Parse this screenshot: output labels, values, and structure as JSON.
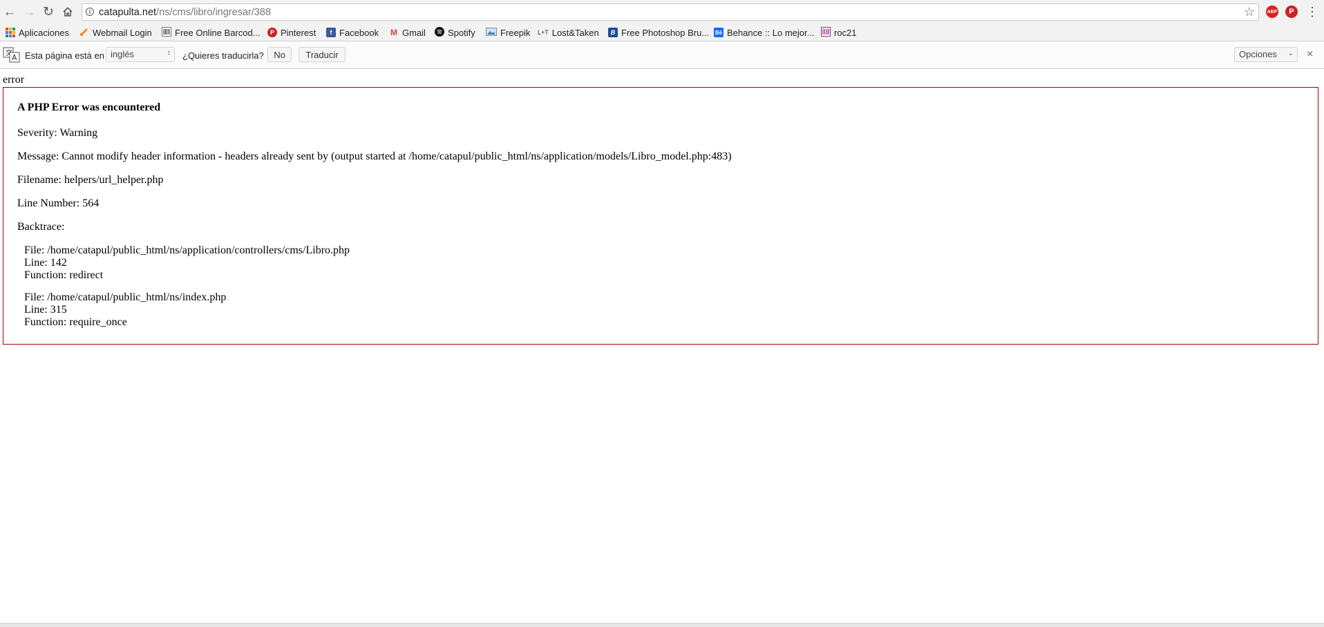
{
  "address_bar": {
    "url_host": "catapulta.net",
    "url_path": "/ns/cms/libro/ingresar/388"
  },
  "extensions": {
    "adblock_label": "ABP",
    "pinterest_label": "P"
  },
  "bookmarks": [
    {
      "label": "Aplicaciones",
      "icon": "apps-grid-icon"
    },
    {
      "label": "Webmail Login",
      "icon": "webmail-icon"
    },
    {
      "label": "Free Online Barcod...",
      "icon": "barcode-icon"
    },
    {
      "label": "Pinterest",
      "icon": "pinterest-icon"
    },
    {
      "label": "Facebook",
      "icon": "facebook-icon"
    },
    {
      "label": "Gmail",
      "icon": "gmail-icon"
    },
    {
      "label": "Spotify",
      "icon": "spotify-icon"
    },
    {
      "label": "Freepik",
      "icon": "freepik-icon"
    },
    {
      "label": "Lost&Taken",
      "icon": "lost-taken-icon"
    },
    {
      "label": "Free Photoshop Bru...",
      "icon": "photoshop-brushes-icon"
    },
    {
      "label": "Behance :: Lo mejor...",
      "icon": "behance-icon"
    },
    {
      "label": "roc21",
      "icon": "roc21-icon"
    }
  ],
  "bookmark_icon_text": {
    "facebook": "f",
    "gmail": "M",
    "lost_taken": "L+T",
    "photoshop": "B",
    "behance": "Bē"
  },
  "translate_bar": {
    "prefix": "Esta página está en",
    "language": "inglés",
    "question": "¿Quieres traducirla?",
    "no_button": "No",
    "translate_button": "Traducir",
    "options": "Opciones"
  },
  "page": {
    "heading_word": "error",
    "error": {
      "title": "A PHP Error was encountered",
      "severity": "Severity: Warning",
      "message": "Message: Cannot modify header information - headers already sent by (output started at /home/catapul/public_html/ns/application/models/Libro_model.php:483)",
      "filename": "Filename: helpers/url_helper.php",
      "line_number": "Line Number: 564",
      "backtrace_label": "Backtrace:",
      "backtrace": [
        {
          "file": "File: /home/catapul/public_html/ns/application/controllers/cms/Libro.php",
          "line": "Line: 142",
          "function": "Function: redirect"
        },
        {
          "file": "File: /home/catapul/public_html/ns/index.php",
          "line": "Line: 315",
          "function": "Function: require_once"
        }
      ]
    }
  },
  "colors": {
    "error_border": "#990000",
    "toolbar_bg": "#f2f2f2"
  }
}
